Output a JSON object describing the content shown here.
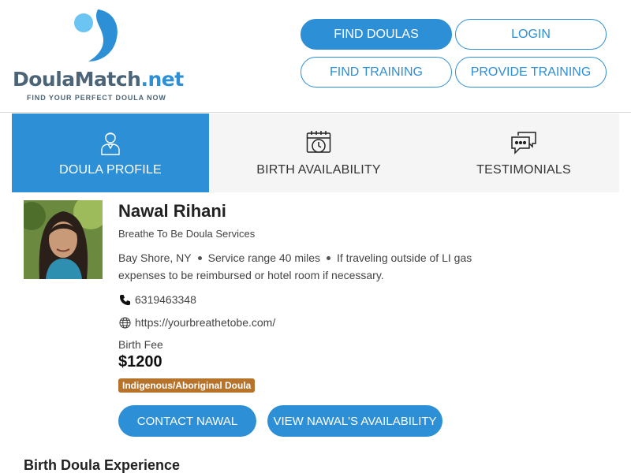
{
  "header": {
    "logo_name_part1": "DoulaMatch",
    "logo_name_part2": ".net",
    "logo_tagline": "FIND YOUR PERFECT DOULA NOW",
    "nav": {
      "find_doulas": "FIND DOULAS",
      "login": "LOGIN",
      "find_training": "FIND TRAINING",
      "provide_training": "PROVIDE TRAINING"
    }
  },
  "tabs": [
    {
      "label": "DOULA PROFILE",
      "icon": "person-icon",
      "active": true
    },
    {
      "label": "BIRTH AVAILABILITY",
      "icon": "calendar-clock-icon",
      "active": false
    },
    {
      "label": "TESTIMONIALS",
      "icon": "chat-bubbles-icon",
      "active": false
    }
  ],
  "profile": {
    "name": "Nawal Rihani",
    "business": "Breathe To Be Doula Services",
    "location": "Bay Shore, NY",
    "service_range": "Service range 40 miles",
    "travel_note": "If traveling outside of LI gas expenses to be reimbursed or hotel room if necessary.",
    "phone": "6319463348",
    "website": "https://yourbreathetobe.com/",
    "fee_label": "Birth Fee",
    "fee_value": "$1200",
    "badge": "Indigenous/Aboriginal Doula",
    "contact_button": "CONTACT NAWAL",
    "availability_button": "VIEW NAWAL'S AVAILABILITY"
  },
  "sections": {
    "experience_heading": "Birth Doula Experience"
  },
  "colors": {
    "brand_blue": "#2d8fd6",
    "logo_text": "#4b6478",
    "badge_bg": "#b8732a",
    "tab_bg": "#f5f5f5"
  }
}
